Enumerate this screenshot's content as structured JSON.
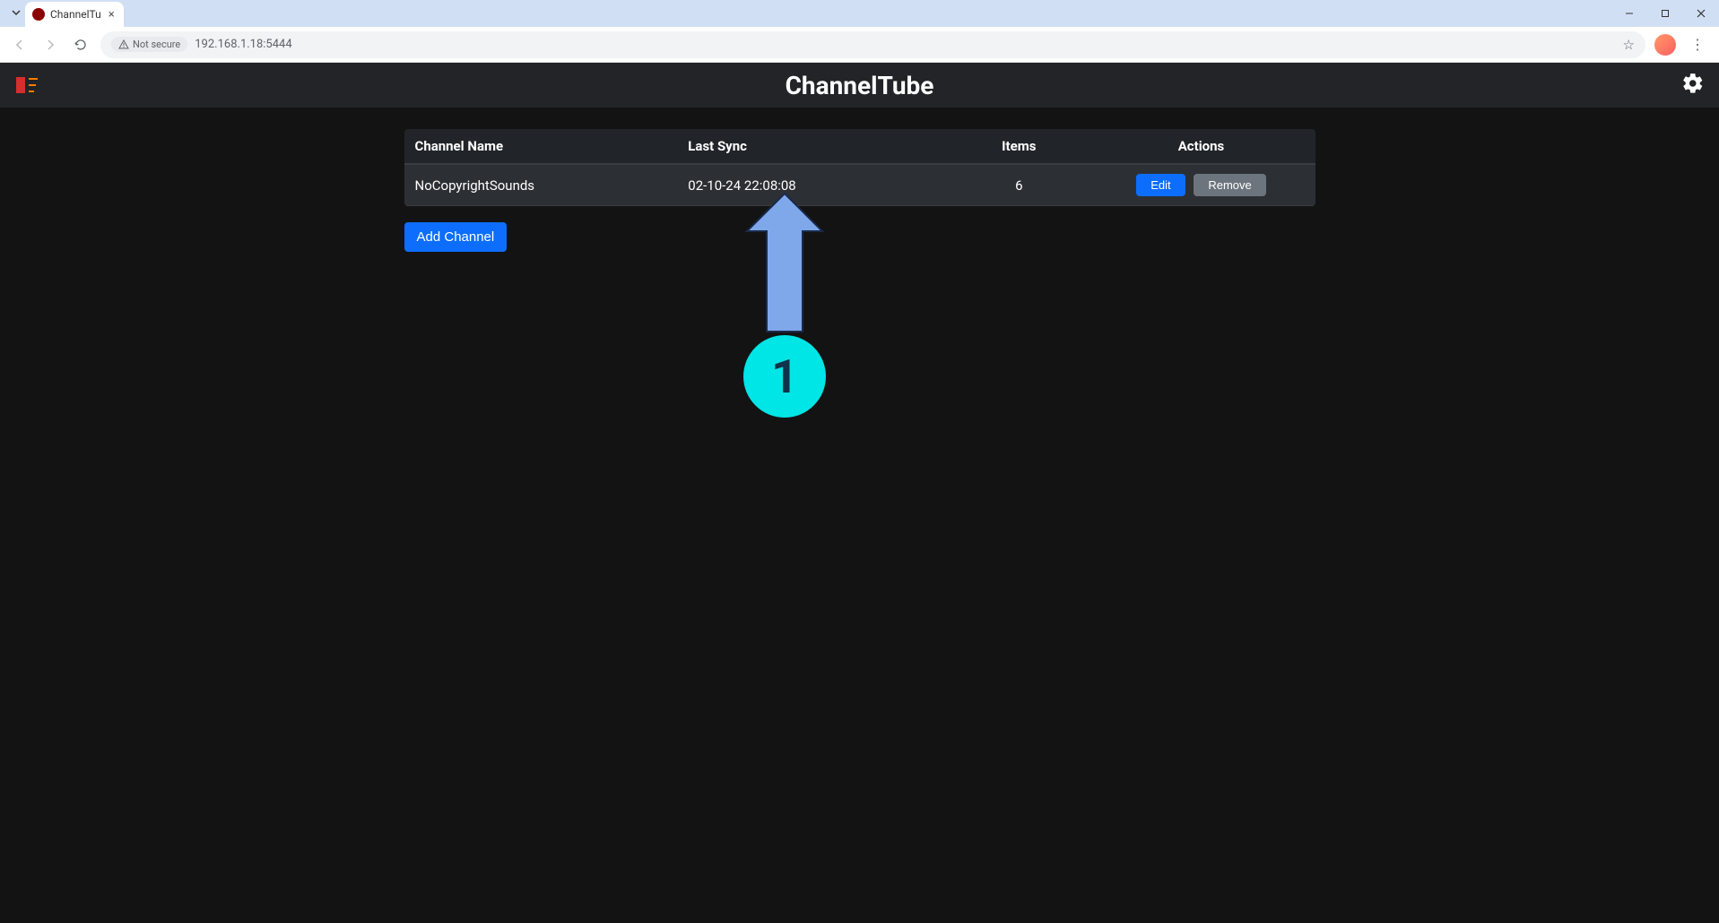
{
  "browser": {
    "tab_title": "ChannelTu",
    "security_label": "Not secure",
    "url": "192.168.1.18:5444"
  },
  "app": {
    "title": "ChannelTube"
  },
  "table": {
    "headers": {
      "name": "Channel Name",
      "sync": "Last Sync",
      "items": "Items",
      "actions": "Actions"
    },
    "rows": [
      {
        "name": "NoCopyrightSounds",
        "sync": "02-10-24 22:08:08",
        "items": "6",
        "edit_label": "Edit",
        "remove_label": "Remove"
      }
    ]
  },
  "buttons": {
    "add_channel": "Add Channel"
  },
  "annotation": {
    "number": "1"
  }
}
